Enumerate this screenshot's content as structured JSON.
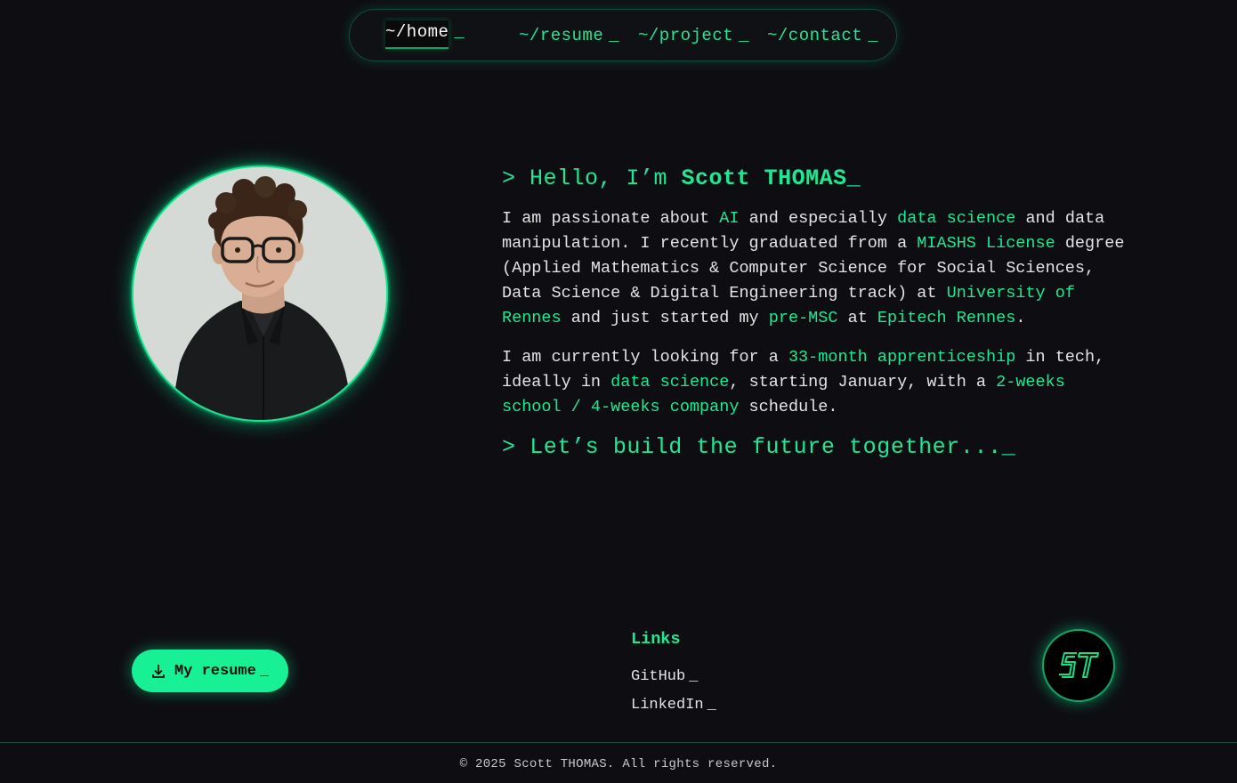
{
  "nav": {
    "items": [
      {
        "label": "~/home",
        "cursor": "_",
        "active": true
      },
      {
        "label": "~/resume",
        "cursor": "_"
      },
      {
        "label": "~/project",
        "cursor": "_"
      },
      {
        "label": "~/contact",
        "cursor": "_"
      }
    ]
  },
  "hero": {
    "greeting_prefix": "> Hello, I’m ",
    "name": "Scott THOMAS_",
    "p1": {
      "t1": "I am passionate about ",
      "h1": "AI",
      "t2": " and especially ",
      "h2": "data science",
      "t3": " and data manipulation. I recently graduated from a ",
      "h3": "MIASHS License",
      "t4": " degree (Applied Mathematics & Computer Science for Social Sciences, Data Science & Digital Engineering track) at ",
      "h4": "University of Rennes",
      "t5": " and just started my ",
      "h5": "pre-MSC",
      "t6": " at ",
      "h6": "Epitech Rennes",
      "t7": "."
    },
    "p2": {
      "t1": "I am currently looking for a ",
      "h1": "33-month apprenticeship",
      "t2": " in tech, ideally in ",
      "h2": "data science",
      "t3": ", starting January, with a ",
      "h3": "2-weeks school / 4-weeks company",
      "t4": " schedule."
    },
    "tagline": "> Let’s build the future together..._"
  },
  "resume_button": {
    "label": "My resume",
    "cursor": "_",
    "icon": "download-icon"
  },
  "links": {
    "title": "Links",
    "items": [
      {
        "label": "GitHub",
        "cursor": "_"
      },
      {
        "label": "LinkedIn",
        "cursor": "_"
      }
    ]
  },
  "logo": {
    "text": "ST"
  },
  "footer": {
    "copyright": "© 2025 Scott THOMAS. All rights reserved."
  },
  "colors": {
    "accent": "#1ee894",
    "background": "#0e0e12",
    "text": "#e4e4e4"
  }
}
